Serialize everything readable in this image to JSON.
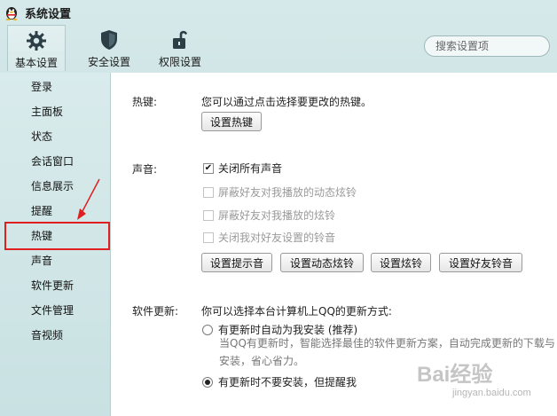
{
  "window": {
    "title": "系统设置"
  },
  "toolbar": {
    "tabs": [
      {
        "label": "基本设置",
        "icon": "gear-icon",
        "active": true
      },
      {
        "label": "安全设置",
        "icon": "shield-icon",
        "active": false
      },
      {
        "label": "权限设置",
        "icon": "unlock-icon",
        "active": false
      }
    ],
    "search": {
      "placeholder": "搜索设置项"
    }
  },
  "sidebar": {
    "items": [
      {
        "label": "登录"
      },
      {
        "label": "主面板"
      },
      {
        "label": "状态"
      },
      {
        "label": "会话窗口"
      },
      {
        "label": "信息展示"
      },
      {
        "label": "提醒"
      },
      {
        "label": "热键"
      },
      {
        "label": "声音"
      },
      {
        "label": "软件更新"
      },
      {
        "label": "文件管理"
      },
      {
        "label": "音视频"
      }
    ],
    "highlighted": "热键"
  },
  "hotkey": {
    "label": "热键:",
    "description": "您可以通过点击选择要更改的热键。",
    "button": "设置热键"
  },
  "sound": {
    "label": "声音:",
    "options": [
      {
        "label": "关闭所有声音",
        "checked": true,
        "disabled": false
      },
      {
        "label": "屏蔽好友对我播放的动态炫铃",
        "checked": false,
        "disabled": true
      },
      {
        "label": "屏蔽好友对我播放的炫铃",
        "checked": false,
        "disabled": true
      },
      {
        "label": "关闭我对好友设置的铃音",
        "checked": false,
        "disabled": true
      }
    ],
    "buttons": [
      "设置提示音",
      "设置动态炫铃",
      "设置炫铃",
      "设置好友铃音"
    ]
  },
  "update": {
    "label": "软件更新:",
    "description": "你可以选择本台计算机上QQ的更新方式:",
    "options": [
      {
        "label": "有更新时自动为我安装 (推荐)",
        "selected": false
      },
      {
        "label": "有更新时不要安装，但提醒我",
        "selected": true
      }
    ],
    "auto_description": "当QQ有更新时，智能选择最佳的软件更新方案，自动完成更新的下载与安装，省心省力。"
  },
  "watermark": {
    "text": "Bai经验",
    "sub": "jingyan.baidu.com"
  },
  "colors": {
    "highlight": "#e02020",
    "accent": "#2a7fbf"
  }
}
